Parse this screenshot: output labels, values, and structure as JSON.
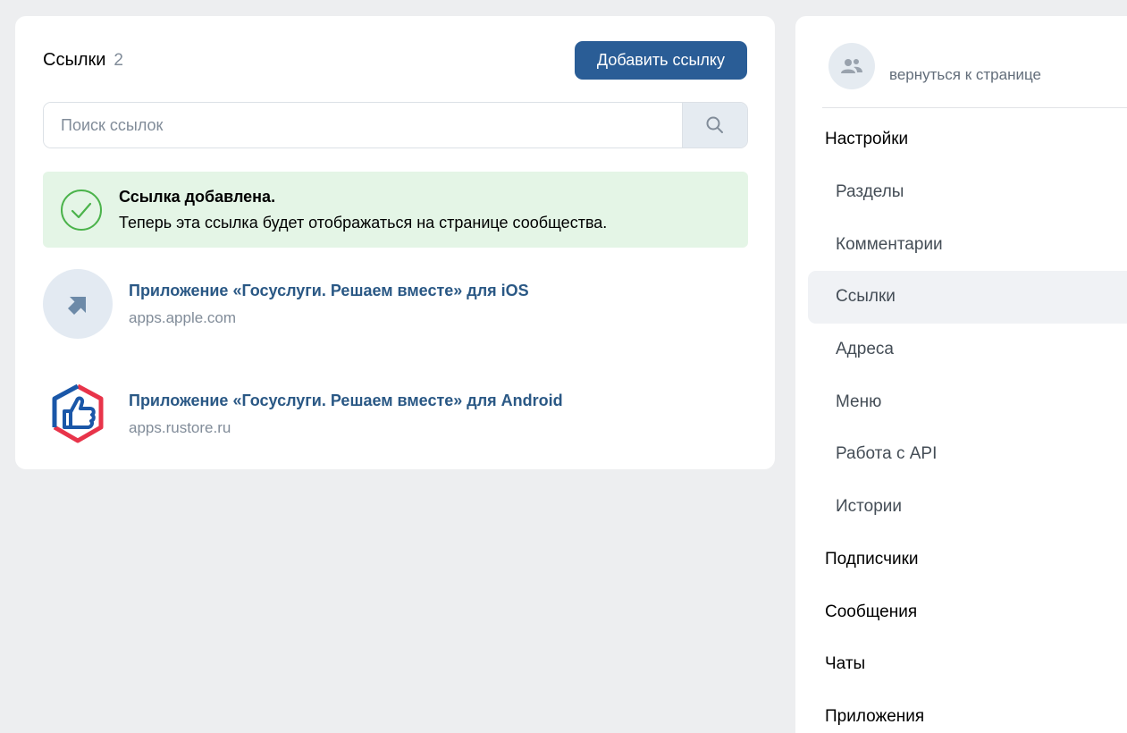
{
  "links_panel": {
    "title": "Ссылки",
    "count": "2",
    "add_button_label": "Добавить ссылку",
    "search": {
      "placeholder": "Поиск ссылок",
      "value": "",
      "icon": "search-icon"
    },
    "alert": {
      "icon": "check-circle-icon",
      "title": "Ссылка добавлена.",
      "message": "Теперь эта ссылка будет отображаться на странице сообщества."
    },
    "items": [
      {
        "title": "Приложение «Госуслуги. Решаем вместе» для iOS",
        "url": "apps.apple.com",
        "icon": "share-arrow-icon"
      },
      {
        "title": "Приложение «Госуслуги. Решаем вместе» для Android",
        "url": "apps.rustore.ru",
        "icon": "gosuslugi-thumbs-up-logo"
      }
    ]
  },
  "sidebar": {
    "back_label": "вернуться к странице",
    "back_icon": "community-icon",
    "menu": [
      {
        "label": "Настройки",
        "level": "top"
      },
      {
        "label": "Разделы",
        "level": "sub"
      },
      {
        "label": "Комментарии",
        "level": "sub"
      },
      {
        "label": "Ссылки",
        "level": "sub",
        "active": true
      },
      {
        "label": "Адреса",
        "level": "sub"
      },
      {
        "label": "Меню",
        "level": "sub"
      },
      {
        "label": "Работа с API",
        "level": "sub"
      },
      {
        "label": "Истории",
        "level": "sub"
      },
      {
        "label": "Подписчики",
        "level": "top"
      },
      {
        "label": "Сообщения",
        "level": "top"
      },
      {
        "label": "Чаты",
        "level": "top"
      },
      {
        "label": "Приложения",
        "level": "top"
      }
    ]
  },
  "colors": {
    "primary_button": "#2a5d96",
    "link": "#2a5885",
    "success_bg": "#e4f5e6",
    "success_icon": "#4bb34b"
  }
}
